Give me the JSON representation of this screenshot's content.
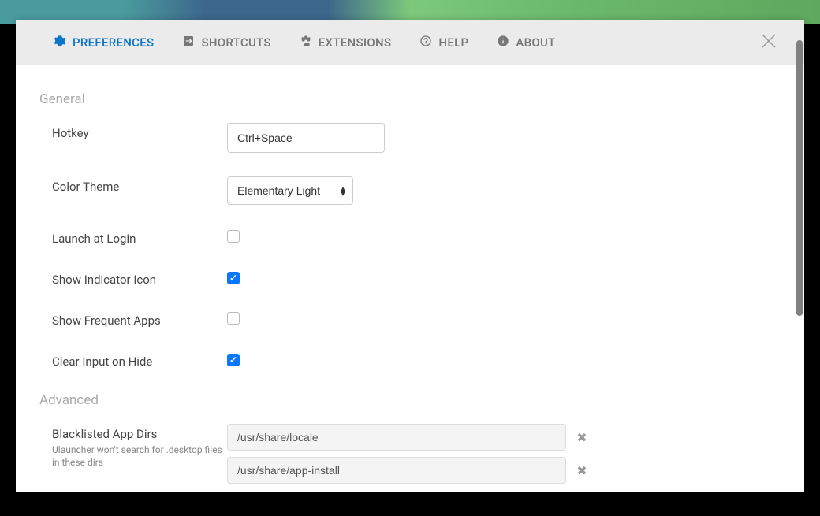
{
  "tabs": {
    "preferences": "PREFERENCES",
    "shortcuts": "SHORTCUTS",
    "extensions": "EXTENSIONS",
    "help": "HELP",
    "about": "ABOUT"
  },
  "sections": {
    "general": "General",
    "advanced": "Advanced"
  },
  "general": {
    "hotkey_label": "Hotkey",
    "hotkey_value": "Ctrl+Space",
    "color_theme_label": "Color Theme",
    "color_theme_value": "Elementary Light",
    "launch_at_login_label": "Launch at Login",
    "launch_at_login_checked": false,
    "show_indicator_label": "Show Indicator Icon",
    "show_indicator_checked": true,
    "show_frequent_label": "Show Frequent Apps",
    "show_frequent_checked": false,
    "clear_input_label": "Clear Input on Hide",
    "clear_input_checked": true
  },
  "advanced": {
    "blacklist_label": "Blacklisted App Dirs",
    "blacklist_sublabel": "Ulauncher won't search for .desktop files in these dirs",
    "blacklist_items": [
      "/usr/share/locale",
      "/usr/share/app-install"
    ]
  }
}
